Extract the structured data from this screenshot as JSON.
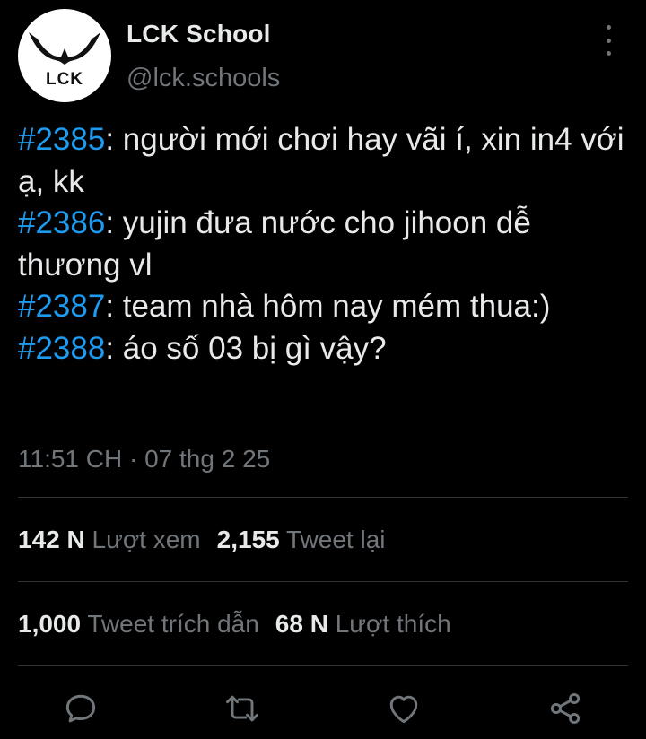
{
  "account": {
    "display_name": "LCK School",
    "handle": "@lck.schools",
    "avatar_text": "LCK"
  },
  "tweet": {
    "lines": [
      {
        "tag": "#2385",
        "text": ": người mới chơi hay vãi í, xin in4 với ạ, kk"
      },
      {
        "tag": "#2386",
        "text": ": yujin đưa nước cho jihoon dễ thương vl"
      },
      {
        "tag": "#2387",
        "text": ": team nhà hôm nay mém thua:)"
      },
      {
        "tag": "#2388",
        "text": ": áo số 03 bị gì vậy?"
      }
    ],
    "timestamp": "11:51 CH · 07 thg 2 25"
  },
  "stats": {
    "views_count": "142 N",
    "views_label": "Lượt xem",
    "retweets_count": "2,155",
    "retweets_label": "Tweet lại",
    "quotes_count": "1,000",
    "quotes_label": "Tweet trích dẫn",
    "likes_count": "68 N",
    "likes_label": "Lượt thích"
  },
  "actions": {
    "reply_icon": "reply-icon",
    "retweet_icon": "retweet-icon",
    "like_icon": "heart-icon",
    "share_icon": "share-icon"
  },
  "colors": {
    "background": "#000000",
    "text": "#e7e9ea",
    "muted": "#71767b",
    "accent": "#1d9bf0",
    "divider": "#2f3336"
  }
}
